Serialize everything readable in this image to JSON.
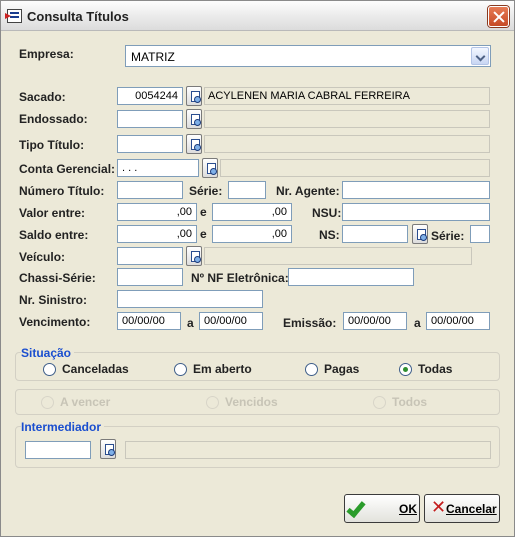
{
  "window": {
    "title": "Consulta Títulos"
  },
  "empresa": {
    "label": "Empresa:",
    "value": "MATRIZ"
  },
  "sacado": {
    "label": "Sacado:",
    "code": "0054244",
    "name": "ACYLENEN MARIA CABRAL FERREIRA"
  },
  "endossado": {
    "label": "Endossado:",
    "code": "",
    "name": ""
  },
  "tipo_titulo": {
    "label": "Tipo Título:",
    "code": "",
    "name": ""
  },
  "conta_gerencial": {
    "label": "Conta Gerencial:",
    "code": ". . .",
    "name": ""
  },
  "numero_titulo": {
    "label": "Número Título:",
    "value": "",
    "serie_label": "Série:",
    "serie": "",
    "agente_label": "Nr. Agente:",
    "agente": ""
  },
  "valor": {
    "label": "Valor entre:",
    "from": ",00",
    "sep": "e",
    "to": ",00",
    "nsu_label": "NSU:",
    "nsu": ""
  },
  "saldo": {
    "label": "Saldo entre:",
    "from": ",00",
    "sep": "e",
    "to": ",00",
    "ns_label": "NS:",
    "ns": "",
    "serie_label": "Série:",
    "serie": ""
  },
  "veiculo": {
    "label": "Veículo:",
    "code": "",
    "name": ""
  },
  "chassi": {
    "label": "Chassi-Série:",
    "value": "",
    "nf_label": "Nº NF Eletrônica:",
    "nf": ""
  },
  "sinistro": {
    "label": "Nr. Sinistro:",
    "value": ""
  },
  "vencimento": {
    "label": "Vencimento:",
    "from": "00/00/00",
    "sep": "a",
    "to": "00/00/00"
  },
  "emissao": {
    "label": "Emissão:",
    "from": "00/00/00",
    "sep": "a",
    "to": "00/00/00"
  },
  "situacao": {
    "title": "Situação",
    "options": [
      "Canceladas",
      "Em aberto",
      "Pagas",
      "Todas"
    ],
    "selected": "Todas"
  },
  "vencimento_filter": {
    "options": [
      "A vencer",
      "Vencidos",
      "Todos"
    ]
  },
  "intermediador": {
    "title": "Intermediador",
    "code": "",
    "name": ""
  },
  "buttons": {
    "ok": "OK",
    "cancel": "Cancelar"
  }
}
